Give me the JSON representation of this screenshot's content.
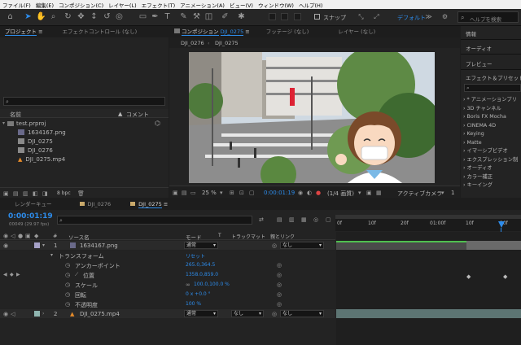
{
  "menu": [
    "ファイル(F)",
    "編集(E)",
    "コンポジション(C)",
    "レイヤー(L)",
    "エフェクト(T)",
    "アニメーション(A)",
    "ビュー(V)",
    "ウィンドウ(W)",
    "ヘルプ(H)"
  ],
  "toolbar": {
    "snap_label": "スナップ",
    "workspace": "デフォルト",
    "help_placeholder": "ヘルプを検索"
  },
  "project": {
    "tab_project": "プロジェクト",
    "tab_effects": "エフェクトコントロール (なし)",
    "col_name": "名前",
    "col_comment": "コメント",
    "items": [
      {
        "name": "test.prproj",
        "type": "folder"
      },
      {
        "name": "1634167.png",
        "type": "image"
      },
      {
        "name": "DJI_0275",
        "type": "comp"
      },
      {
        "name": "DJI_0276",
        "type": "comp"
      },
      {
        "name": "DJI_0275.mp4",
        "type": "video"
      }
    ],
    "bpc": "8 bpc"
  },
  "viewer": {
    "tab_comp": "コンポジション",
    "comp_name": "DJI_0275",
    "tab_footage": "フッテージ (なし)",
    "tab_layer": "レイヤー (なし)",
    "breadcrumb_1": "DJI_0276",
    "breadcrumb_2": "DJI_0275",
    "zoom": "25 %",
    "time": "0:00:01:19",
    "resolution": "(1/4 画質)",
    "camera": "アクティブカメラ"
  },
  "right_panel": {
    "items": [
      "情報",
      "オーディオ",
      "プレビュー",
      "エフェクト＆プリセット"
    ],
    "effects": [
      "* アニメーションプリ",
      "3D チャンネル",
      "Boris FX Mocha",
      "CINEMA 4D",
      "Keying",
      "Matte",
      "イマーシブビデオ",
      "エクスプレッション制",
      "オーディオ",
      "カラー補正",
      "キーイング"
    ]
  },
  "timeline": {
    "tabs": [
      "レンダーキュー",
      "DJI_0276",
      "DJI_0275"
    ],
    "timecode": "0:00:01:19",
    "frames": "00049 (29.97 fps)",
    "col_source": "ソース名",
    "col_mode": "モード",
    "col_trackmatte": "トラックマット",
    "col_parent": "親とリンク",
    "ruler": [
      "0f",
      "10f",
      "20f",
      "01:00f",
      "10f",
      "20f"
    ],
    "layers": [
      {
        "num": "1",
        "name": "1634167.png",
        "mode": "通常",
        "parent": "なし",
        "color": "#a6a2c8"
      },
      {
        "num": "2",
        "name": "DJI_0275.mp4",
        "mode": "通常",
        "matte": "なし",
        "parent": "なし",
        "color": "#8fb5b0"
      }
    ],
    "transform_label": "トランスフォーム",
    "reset_label": "リセット",
    "props": [
      {
        "name": "アンカーポイント",
        "value": "265.0,364.5"
      },
      {
        "name": "位置",
        "value": "1358.0,859.0"
      },
      {
        "name": "スケール",
        "value": "100.0,100.0 %"
      },
      {
        "name": "回転",
        "value": "0 x +0.0 °"
      },
      {
        "name": "不透明度",
        "value": "100 %"
      }
    ]
  },
  "colors": {
    "accent": "#2d8ceb",
    "panel": "#232323",
    "bg": "#1d1d1d"
  }
}
